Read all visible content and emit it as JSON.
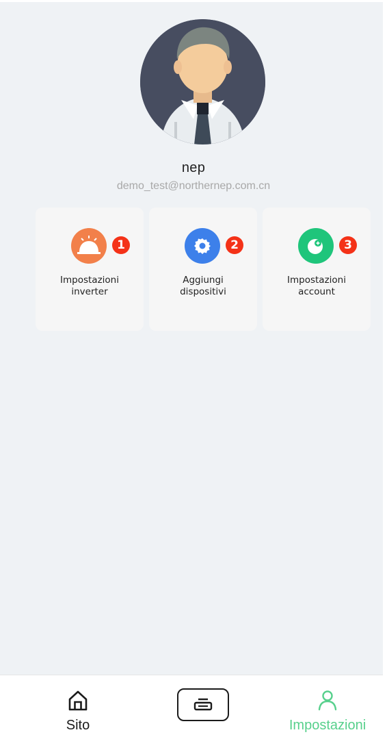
{
  "profile": {
    "name": "nep",
    "email": "demo_test@northernep.com.cn"
  },
  "tiles": [
    {
      "icon": "sun-icon",
      "color": "#f2804a",
      "badge": "1",
      "label_line1": "Impostazioni",
      "label_line2": "inverter"
    },
    {
      "icon": "gear-icon",
      "color": "#3d80ea",
      "badge": "2",
      "label_line1": "Aggiungi",
      "label_line2": "dispositivi"
    },
    {
      "icon": "account-icon",
      "color": "#1fc57b",
      "badge": "3",
      "label_line1": "Impostazioni",
      "label_line2": "account"
    }
  ],
  "bottom_nav": {
    "items": [
      {
        "label": "Sito",
        "icon": "home-icon",
        "active": false
      },
      {
        "label": "",
        "icon": "device-icon",
        "active": false
      },
      {
        "label": "Impostazioni",
        "icon": "user-icon",
        "active": true
      }
    ],
    "active_color": "#57d08c"
  },
  "colors": {
    "background": "#eff2f5",
    "badge": "#f43218"
  }
}
